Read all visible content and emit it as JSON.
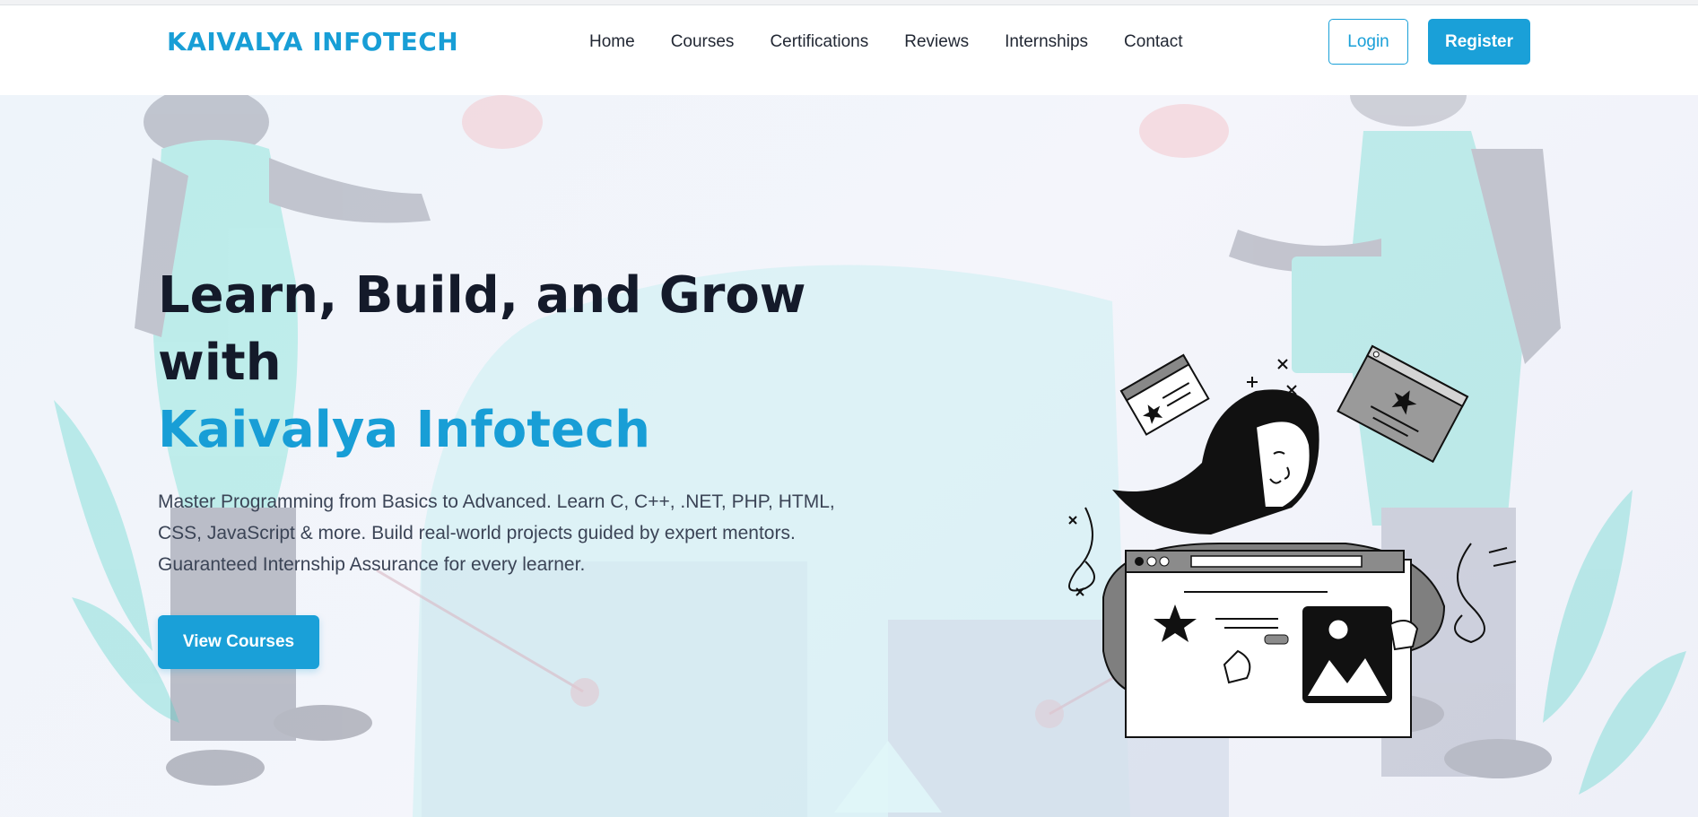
{
  "brand": {
    "name": "KAIVALYA INFOTECH",
    "accent_color": "#1aa0d8"
  },
  "nav": {
    "items": [
      {
        "label": "Home"
      },
      {
        "label": "Courses"
      },
      {
        "label": "Certifications"
      },
      {
        "label": "Reviews"
      },
      {
        "label": "Internships"
      },
      {
        "label": "Contact"
      }
    ],
    "login_label": "Login",
    "register_label": "Register"
  },
  "hero": {
    "headline_line1": "Learn, Build, and Grow",
    "headline_line2": "with",
    "headline_accent": "Kaivalya Infotech",
    "description": "Master Programming from Basics to Advanced. Learn C, C++, .NET, PHP, HTML, CSS, JavaScript & more. Build real-world projects guided by expert mentors. Guaranteed Internship Assurance for every learner.",
    "cta_label": "View Courses",
    "illustration_icon": "woman-holding-browser-window-illustration"
  }
}
